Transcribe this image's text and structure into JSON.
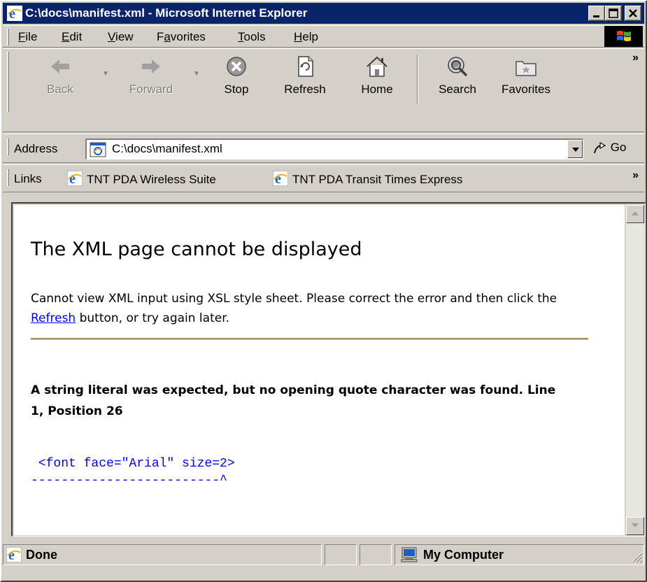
{
  "window": {
    "title": "C:\\docs\\manifest.xml - Microsoft Internet Explorer"
  },
  "menu": {
    "items": [
      {
        "label": "File",
        "accel": "F",
        "rest": "ile"
      },
      {
        "label": "Edit",
        "accel": "E",
        "rest": "dit"
      },
      {
        "label": "View",
        "accel": "V",
        "rest": "iew"
      },
      {
        "label": "Favorites",
        "accel": "a",
        "pre": "F",
        "rest": "vorites"
      },
      {
        "label": "Tools",
        "accel": "T",
        "rest": "ools"
      },
      {
        "label": "Help",
        "accel": "H",
        "rest": "elp"
      }
    ]
  },
  "toolbar": {
    "back": "Back",
    "forward": "Forward",
    "stop": "Stop",
    "refresh": "Refresh",
    "home": "Home",
    "search": "Search",
    "favorites": "Favorites",
    "more": "»"
  },
  "address": {
    "label": "Address",
    "value": "C:\\docs\\manifest.xml",
    "go": "Go"
  },
  "links": {
    "label": "Links",
    "items": [
      "TNT PDA Wireless Suite",
      "TNT PDA Transit Times Express"
    ],
    "more": "»"
  },
  "page": {
    "heading": "The XML page cannot be displayed",
    "desc_before": "Cannot view XML input using XSL style sheet. Please correct the error and then click the ",
    "desc_link": "Refresh",
    "desc_after": " button, or try again later.",
    "error_message": "A string literal was expected, but no opening quote character was found. Line 1, Position 26",
    "source_line": " <font face=\"Arial\" size=2>",
    "pointer_line": "-------------------------^"
  },
  "status": {
    "text": "Done",
    "zone": "My Computer"
  },
  "colors": {
    "titlebar": "#0a246a",
    "chrome": "#d4d0c8",
    "link": "#0000ff"
  }
}
